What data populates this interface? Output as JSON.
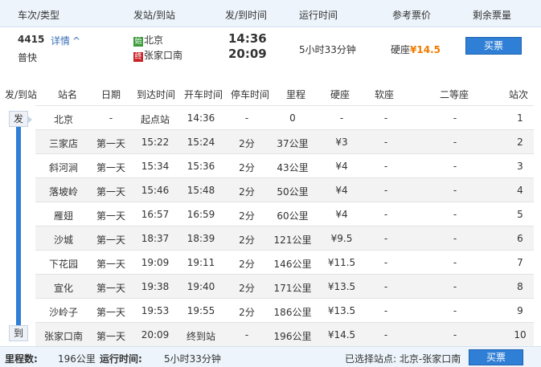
{
  "header": {
    "cols": [
      "车次/类型",
      "发站/到站",
      "发/到时间",
      "运行时间",
      "参考票价",
      "剩余票量"
    ]
  },
  "train": {
    "code": "4415",
    "detail_label": "详情",
    "type": "普快",
    "from_badge": "始",
    "from_station": "北京",
    "to_badge": "终",
    "to_station": "张家口南",
    "depart_time": "14:36",
    "arrive_time": "20:09",
    "duration": "5小时33分钟",
    "price_class": "硬座",
    "price": "¥14.5",
    "buy_label": "买票"
  },
  "stops_table": {
    "columns": [
      "发/到站",
      "站名",
      "日期",
      "到达时间",
      "开车时间",
      "停车时间",
      "里程",
      "硬座",
      "软座",
      "二等座",
      "站次"
    ],
    "rows": [
      {
        "name": "北京",
        "date": "-",
        "arrive": "起点站",
        "depart": "14:36",
        "stop": "-",
        "dist": "0",
        "hard": "-",
        "soft": "-",
        "second": "-",
        "seq": "1"
      },
      {
        "name": "三家店",
        "date": "第一天",
        "arrive": "15:22",
        "depart": "15:24",
        "stop": "2分",
        "dist": "37公里",
        "hard": "¥3",
        "soft": "-",
        "second": "-",
        "seq": "2"
      },
      {
        "name": "斜河涧",
        "date": "第一天",
        "arrive": "15:34",
        "depart": "15:36",
        "stop": "2分",
        "dist": "43公里",
        "hard": "¥4",
        "soft": "-",
        "second": "-",
        "seq": "3"
      },
      {
        "name": "落坡岭",
        "date": "第一天",
        "arrive": "15:46",
        "depart": "15:48",
        "stop": "2分",
        "dist": "50公里",
        "hard": "¥4",
        "soft": "-",
        "second": "-",
        "seq": "4"
      },
      {
        "name": "雁翅",
        "date": "第一天",
        "arrive": "16:57",
        "depart": "16:59",
        "stop": "2分",
        "dist": "60公里",
        "hard": "¥4",
        "soft": "-",
        "second": "-",
        "seq": "5"
      },
      {
        "name": "沙城",
        "date": "第一天",
        "arrive": "18:37",
        "depart": "18:39",
        "stop": "2分",
        "dist": "121公里",
        "hard": "¥9.5",
        "soft": "-",
        "second": "-",
        "seq": "6"
      },
      {
        "name": "下花园",
        "date": "第一天",
        "arrive": "19:09",
        "depart": "19:11",
        "stop": "2分",
        "dist": "146公里",
        "hard": "¥11.5",
        "soft": "-",
        "second": "-",
        "seq": "7"
      },
      {
        "name": "宣化",
        "date": "第一天",
        "arrive": "19:38",
        "depart": "19:40",
        "stop": "2分",
        "dist": "171公里",
        "hard": "¥13.5",
        "soft": "-",
        "second": "-",
        "seq": "8"
      },
      {
        "name": "沙岭子",
        "date": "第一天",
        "arrive": "19:53",
        "depart": "19:55",
        "stop": "2分",
        "dist": "186公里",
        "hard": "¥13.5",
        "soft": "-",
        "second": "-",
        "seq": "9"
      },
      {
        "name": "张家口南",
        "date": "第一天",
        "arrive": "20:09",
        "depart": "终到站",
        "stop": "-",
        "dist": "196公里",
        "hard": "¥14.5",
        "soft": "-",
        "second": "-",
        "seq": "10"
      }
    ],
    "rail_start_label": "发",
    "rail_end_label": "到"
  },
  "footer": {
    "distance_label": "里程数:",
    "distance_value": "196公里",
    "runtime_label": "运行时间:",
    "runtime_value": "5小时33分钟",
    "selected_label": "已选择站点: 北京-张家口南",
    "buy_label": "买票"
  },
  "colors": {
    "accent_blue": "#2f7fd6",
    "price_orange": "#f07b00",
    "start_green": "#3a9b3a",
    "end_red": "#c8242a"
  }
}
